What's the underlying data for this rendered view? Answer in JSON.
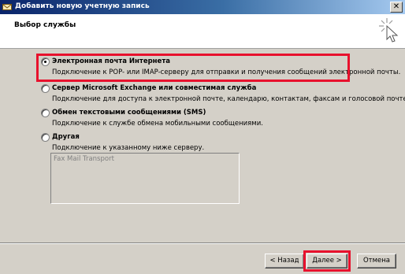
{
  "window": {
    "title": "Добавить новую учетную запись",
    "close_label": "✕"
  },
  "header": {
    "title": "Выбор службы",
    "icon": "cursor-click-icon"
  },
  "options": [
    {
      "label": "Электронная почта Интернета",
      "description": "Подключение к POP- или IMAP-серверу для отправки и получения сообщений электронной почты.",
      "selected": true
    },
    {
      "label": "Сервер Microsoft Exchange или совместимая служба",
      "description": "Подключение для доступа к электронной почте, календарю, контактам, факсам и голосовой почте.",
      "selected": false
    },
    {
      "label": "Обмен текстовыми сообщениями (SMS)",
      "description": "Подключение к службе обмена мобильными сообщениями.",
      "selected": false
    },
    {
      "label": "Другая",
      "description": "Подключение к указанному ниже серверу.",
      "selected": false
    }
  ],
  "server_list": {
    "items": [
      "Fax Mail Transport"
    ]
  },
  "buttons": {
    "back": "< Назад",
    "next": "Далее >",
    "cancel": "Отмена"
  },
  "colors": {
    "highlight": "#e8112d",
    "titlebar": "#0a246a",
    "dialog_bg": "#d4d0c8"
  }
}
